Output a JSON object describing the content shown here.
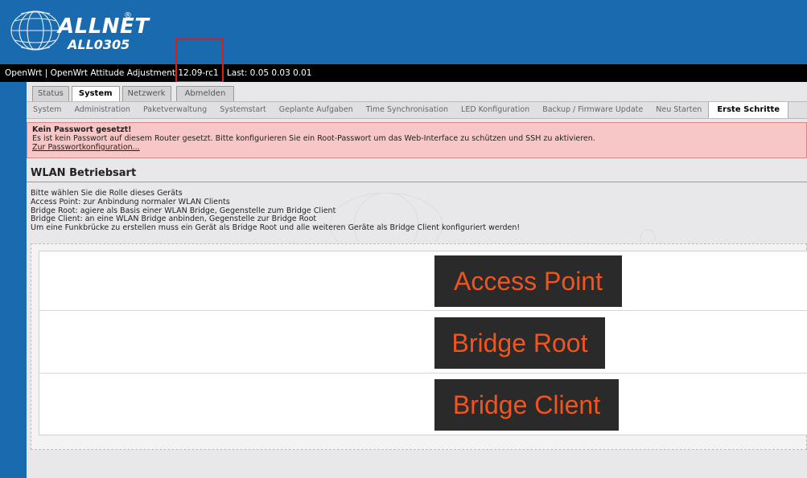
{
  "header": {
    "brand": "ALLNET",
    "brand_mark": "®",
    "model": "ALL0305"
  },
  "statusbar": {
    "text": "OpenWrt | OpenWrt Attitude Adjustment 12.09-rc1 | Last: 0.05 0.03 0.01"
  },
  "tabs_main": [
    {
      "label": "Status"
    },
    {
      "label": "System"
    },
    {
      "label": "Netzwerk"
    },
    {
      "label": "Abmelden"
    }
  ],
  "tabs_sub": [
    {
      "label": "System"
    },
    {
      "label": "Administration"
    },
    {
      "label": "Paketverwaltung"
    },
    {
      "label": "Systemstart"
    },
    {
      "label": "Geplante Aufgaben"
    },
    {
      "label": "Time Synchronisation"
    },
    {
      "label": "LED Konfiguration"
    },
    {
      "label": "Backup / Firmware Update"
    },
    {
      "label": "Neu Starten"
    },
    {
      "label": "Erste Schritte"
    }
  ],
  "alert": {
    "title": "Kein Passwort gesetzt!",
    "message": "Es ist kein Passwort auf diesem Router gesetzt. Bitte konfigurieren Sie ein Root-Passwort um das Web-Interface zu schützen und SSH zu aktivieren.",
    "link": "Zur Passwortkonfiguration..."
  },
  "section": {
    "title": "WLAN Betriebsart",
    "lines": [
      "Bitte wählen Sie die Rolle dieses Geräts",
      "Access Point: zur Anbindung normaler WLAN Clients",
      "Bridge Root: agiere als Basis einer WLAN Bridge, Gegenstelle zum Bridge Client",
      "Bridge Client: an eine WLAN Bridge anbinden, Gegenstelle zur Bridge Root",
      "Um eine Funkbrücke zu erstellen muss ein Gerät als Bridge Root und alle weiteren Geräte als Bridge Client konfiguriert werden!"
    ]
  },
  "modes": [
    {
      "label": "Access Point"
    },
    {
      "label": "Bridge Root"
    },
    {
      "label": "Bridge Client"
    }
  ],
  "colors": {
    "header_blue": "#1a6aaf",
    "statusbar": "#000000",
    "alert_bg": "#f7c7c7",
    "mode_button_bg": "#2a2a2a",
    "mode_button_text": "#f2541c",
    "highlight_box": "#d42020"
  }
}
